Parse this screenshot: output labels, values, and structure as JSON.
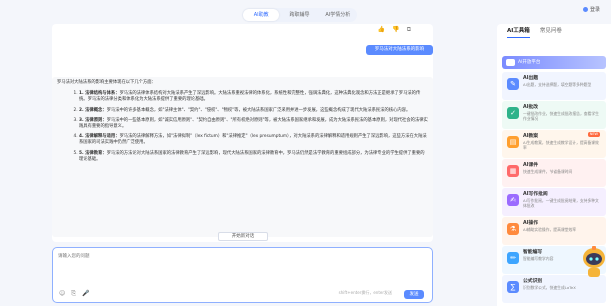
{
  "top_tabs": [
    "AI助教",
    "跨职辅导",
    "AI学情分析"
  ],
  "side_tabs": [
    "AI工具箱",
    "常见问卷"
  ],
  "login": "登录",
  "user_message": "罗马法对大陆法系的影响",
  "answer": {
    "intro": "罗马法对大陆法系的影响主要体现在以下几个方面：",
    "items": [
      {
        "title": "1. 法律结构与体系：",
        "body": "罗马法的法律体系结构对大陆法系产生了深远影响。大陆法系重视法律的体系化，系统性和完整性，强调法典化，这种法典化观念和方法正是继承了罗马法的传统。罗马法的法律分类和体系化为大陆法系提供了重要的理论基础。"
      },
      {
        "title": "2. 法律概念：",
        "body": "罗马法中的许多基本概念，如\"法律主体\"、\"契约\"、\"侵权\"、\"物权\"等，被大陆法系国家广泛采用并进一步发展，这些概念构成了现代大陆法系民法的核心内容。"
      },
      {
        "title": "3. 法律原则：",
        "body": "罗马法中的一些基本原则，如\"诚实信用原则\"、\"契约自由原则\"、\"所有权绝对原则\"等，被大陆法系国家继承和发展，成为大陆法系民法的基本原则，对现代社会的法律实践具有重要的指导意义。"
      },
      {
        "title": "4. 法律解释与适用：",
        "body": "罗马法的法律解释方法，如\"法律拟制\"（lex fictum）和\"法律推定\"（lex presumptum），对大陆法系的法律解释和适用规则产生了深远影响，这些方法在大陆法系国家的司法实践中仍然广泛使用。"
      },
      {
        "title": "5. 法律教育：",
        "body": "罗马法的方法论对大陆法系国家的法律教育产生了深远影响，现代大陆法系国家的法律教育中，罗马法仍然是法学教育的重要组成部分，为法律专业的学生提供了重要的理论基础。"
      }
    ]
  },
  "summary_button": "开始新对话",
  "input": {
    "placeholder": "请输入您的问题",
    "hint": "shift+enter换行，enter发送",
    "send": "发送"
  },
  "platform_label": "AI开放平台",
  "tools": [
    {
      "title": "AI出题",
      "desc": "AI出题，支持选择题，填空题等多种题型",
      "color": "#5b8bff",
      "icon": "document-icon",
      "glyph": "✎",
      "tag": ""
    },
    {
      "title": "AI批改",
      "desc": "一键批改作业，快速生成批改报告，查看学生作业情况",
      "color": "#2fb38a",
      "icon": "check-icon",
      "glyph": "✓",
      "tag": ""
    },
    {
      "title": "AI教案",
      "desc": "AI生成教案，快速生成教学设计，提高备课效率",
      "color": "#ff9f2e",
      "icon": "book-icon",
      "glyph": "▤",
      "tag": "NEW"
    },
    {
      "title": "AI课件",
      "desc": "快速生成课件，节省备课时间",
      "color": "#ff6a6a",
      "icon": "slides-icon",
      "glyph": "▦",
      "tag": ""
    },
    {
      "title": "AI写作批阅",
      "desc": "AI写作批阅，一键生成批阅结果，支持多种文体批改",
      "color": "#9b6bff",
      "icon": "pen-icon",
      "glyph": "✍",
      "tag": ""
    },
    {
      "title": "AI操作",
      "desc": "AI辅助实验操作，提高课堂效率",
      "color": "#ff8a3d",
      "icon": "flask-icon",
      "glyph": "⚗",
      "tag": ""
    },
    {
      "title": "智能编写",
      "desc": "智能编写教学内容",
      "color": "#3da5ff",
      "icon": "edit-icon",
      "glyph": "✏",
      "tag": ""
    },
    {
      "title": "公式识别",
      "desc": "识别数学公式，快速生成LaTeX",
      "color": "#5b8bff",
      "icon": "formula-icon",
      "glyph": "∑",
      "tag": ""
    }
  ]
}
